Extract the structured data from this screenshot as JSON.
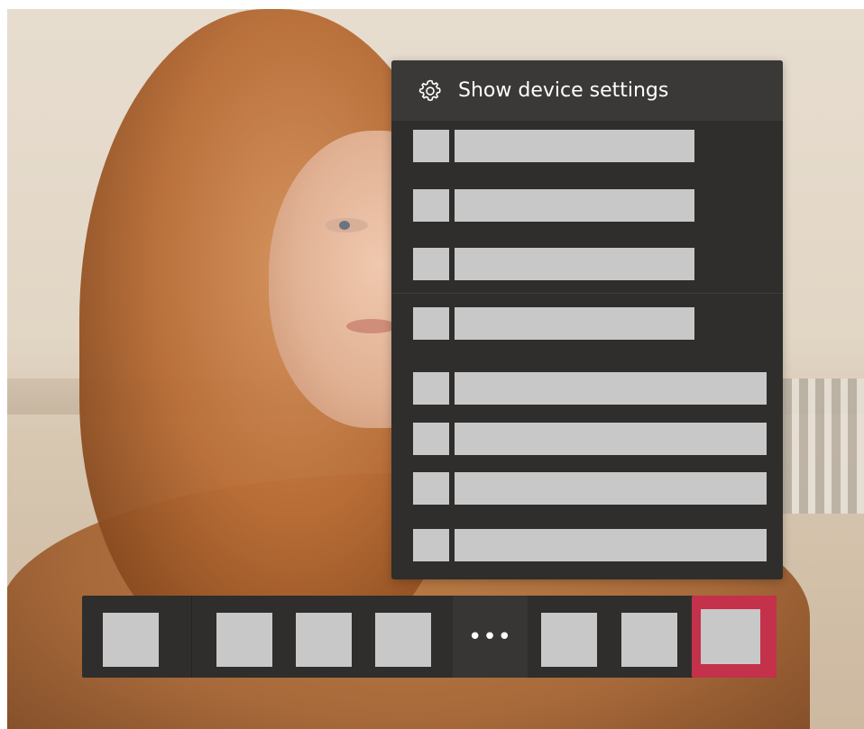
{
  "menu": {
    "header_label": "Show device settings",
    "header_icon": "gear-icon",
    "items": [
      {
        "icon": "placeholder-icon",
        "label": ""
      },
      {
        "icon": "placeholder-icon",
        "label": ""
      },
      {
        "icon": "placeholder-icon",
        "label": ""
      },
      {
        "icon": "placeholder-icon",
        "label": ""
      },
      {
        "icon": "placeholder-icon",
        "label": ""
      },
      {
        "icon": "placeholder-icon",
        "label": ""
      },
      {
        "icon": "placeholder-icon",
        "label": ""
      },
      {
        "icon": "placeholder-icon",
        "label": ""
      }
    ]
  },
  "toolbar": {
    "more_label": "•••",
    "hangup_color": "#c4314b"
  },
  "colors": {
    "menu_bg": "#2f2e2c",
    "placeholder": "#c8c8c8"
  }
}
